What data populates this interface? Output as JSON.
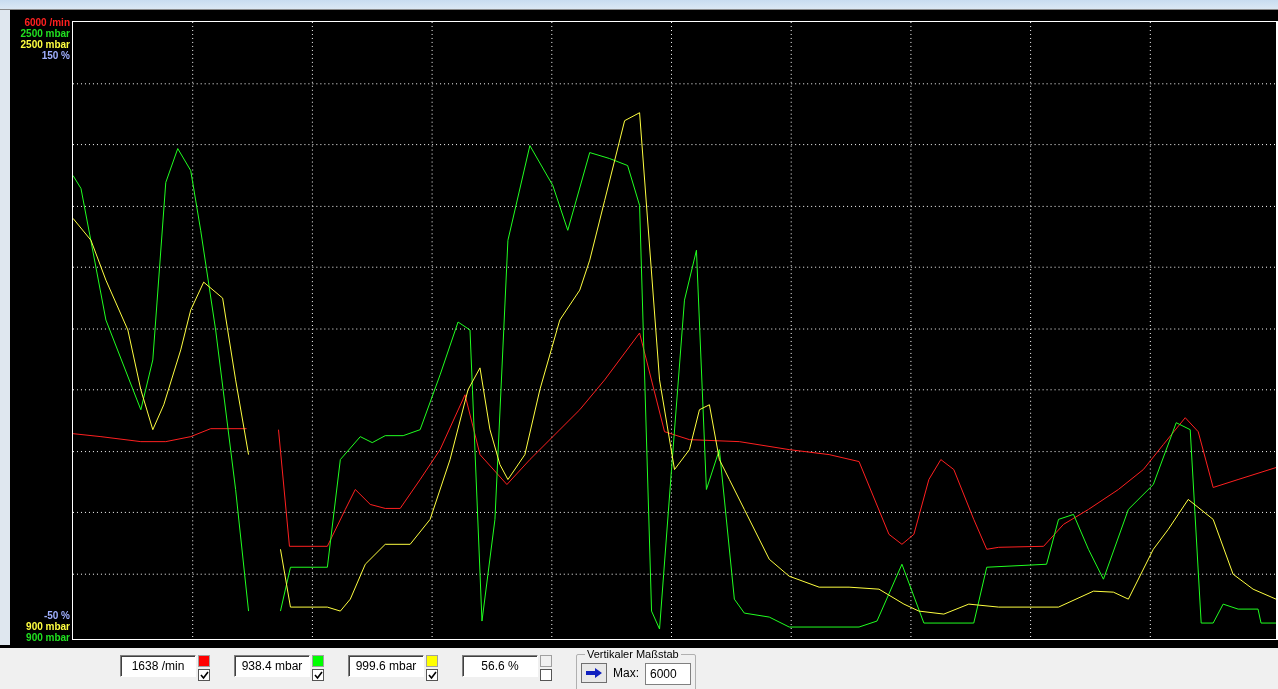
{
  "axis_top": [
    {
      "label": "6000 /min",
      "color": "#ff2020"
    },
    {
      "label": "2500 mbar",
      "color": "#20e020"
    },
    {
      "label": "2500 mbar",
      "color": "#ffff40"
    },
    {
      "label": "150 %",
      "color": "#a0b0ff"
    }
  ],
  "axis_bottom": [
    {
      "label": "-50 %",
      "color": "#a0b0ff"
    },
    {
      "label": "900 mbar",
      "color": "#ffff40"
    },
    {
      "label": "900 mbar",
      "color": "#20e020"
    }
  ],
  "channels": [
    {
      "value": "1638 /min",
      "color": "#ff0000",
      "checked": true
    },
    {
      "value": "938.4 mbar",
      "color": "#00ff00",
      "checked": true
    },
    {
      "value": "999.6 mbar",
      "color": "#ffff00",
      "checked": true
    },
    {
      "value": "56.6 %",
      "checked": false
    }
  ],
  "scale": {
    "title": "Vertikaler Maßstab",
    "max_label": "Max:",
    "max_value": "6000"
  }
}
